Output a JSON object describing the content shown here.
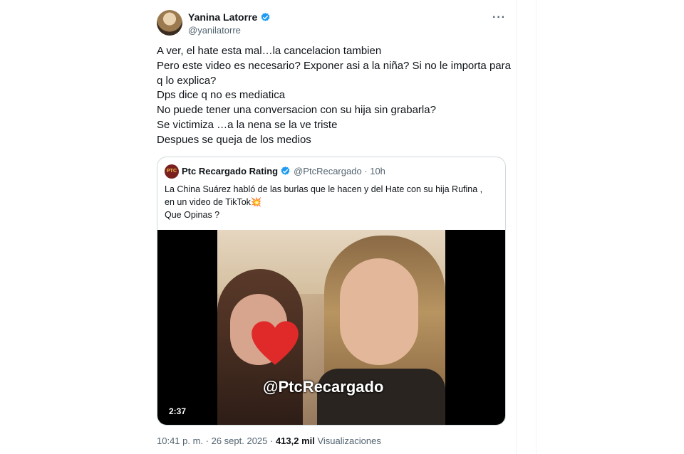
{
  "author": {
    "name": "Yanina Latorre",
    "handle": "@yanilatorre",
    "more_glyph": "···",
    "verified_icon": "verified-badge-icon",
    "accent": "#1d9bf0"
  },
  "tweet_lines": [
    "A ver, el hate esta mal…la cancelacion tambien",
    "Pero este video es necesario? Exponer asi a la niña? Si no le importa para",
    "q lo explica?",
    "Dps dice q no es mediatica",
    "No puede tener una conversacion con su hija sin grabarla?",
    "Se victimiza …a la nena se la ve triste",
    "Despues se queja de los medios"
  ],
  "quote": {
    "avatar_text": "PTC",
    "name": "Ptc Recargado Rating",
    "handle_time": "@PtcRecargado · 10h",
    "lines": [
      "La China Suárez habló de las burlas que le hacen y del Hate con su hija Rufina ,",
      "en un video de TikTok💥",
      "Que Opinas ?"
    ],
    "video": {
      "watermark": "@PtcRecargado",
      "duration": "2:37"
    }
  },
  "meta": {
    "datetime": "10:41 p. m. · 26 sept. 2025 · ",
    "views_count": "413,2 mil",
    "views_label": " Visualizaciones"
  }
}
